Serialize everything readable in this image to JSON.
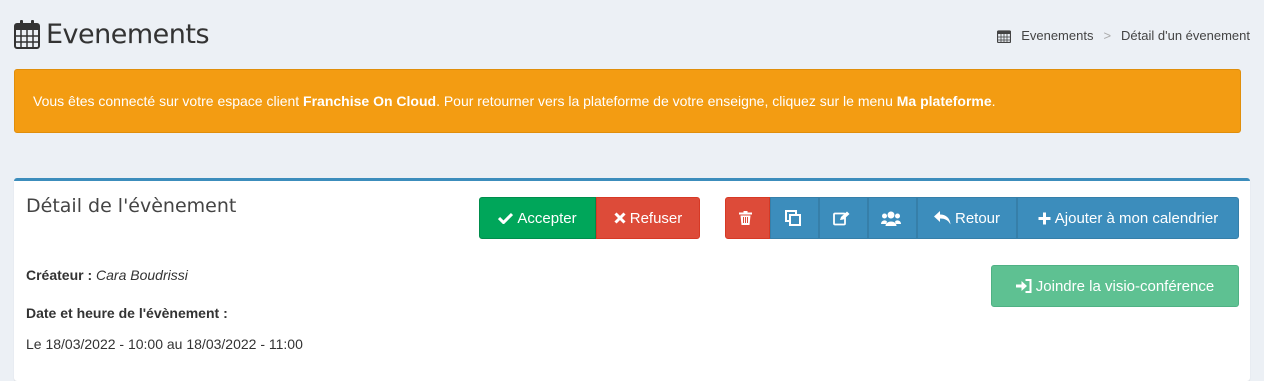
{
  "header": {
    "title": "Evenements"
  },
  "breadcrumb": {
    "items": [
      "Evenements",
      "Détail d'un évenement"
    ],
    "separator": ">"
  },
  "alert": {
    "text_before": "Vous êtes connecté sur votre espace client ",
    "client_name": "Franchise On Cloud",
    "text_middle": ". Pour retourner vers la plateforme de votre enseigne, cliquez sur le menu ",
    "menu_name": "Ma plateforme",
    "text_after": "."
  },
  "box": {
    "title": "Détail de l'évènement"
  },
  "actions": {
    "accept_label": "Accepter",
    "refuse_label": "Refuser",
    "return_label": "Retour",
    "add_calendar_label": "Ajouter à mon calendrier",
    "visio_label": "Joindre la visio-conférence"
  },
  "details": {
    "creator_label": "Créateur :",
    "creator_value": "Cara Boudrissi",
    "datetime_label": "Date et heure de l'évènement :",
    "datetime_value": "Le 18/03/2022 - 10:00 au 18/03/2022 - 11:00"
  },
  "colors": {
    "background": "#ecf0f5",
    "warning": "#f39c12",
    "success": "#00a65a",
    "danger": "#dd4b39",
    "primary": "#3c8dbc",
    "visio": "#5ec192"
  },
  "icons": [
    "calendar-icon",
    "check-icon",
    "times-icon",
    "trash-icon",
    "copy-icon",
    "edit-icon",
    "users-icon",
    "reply-icon",
    "plus-icon",
    "sign-in-icon"
  ]
}
